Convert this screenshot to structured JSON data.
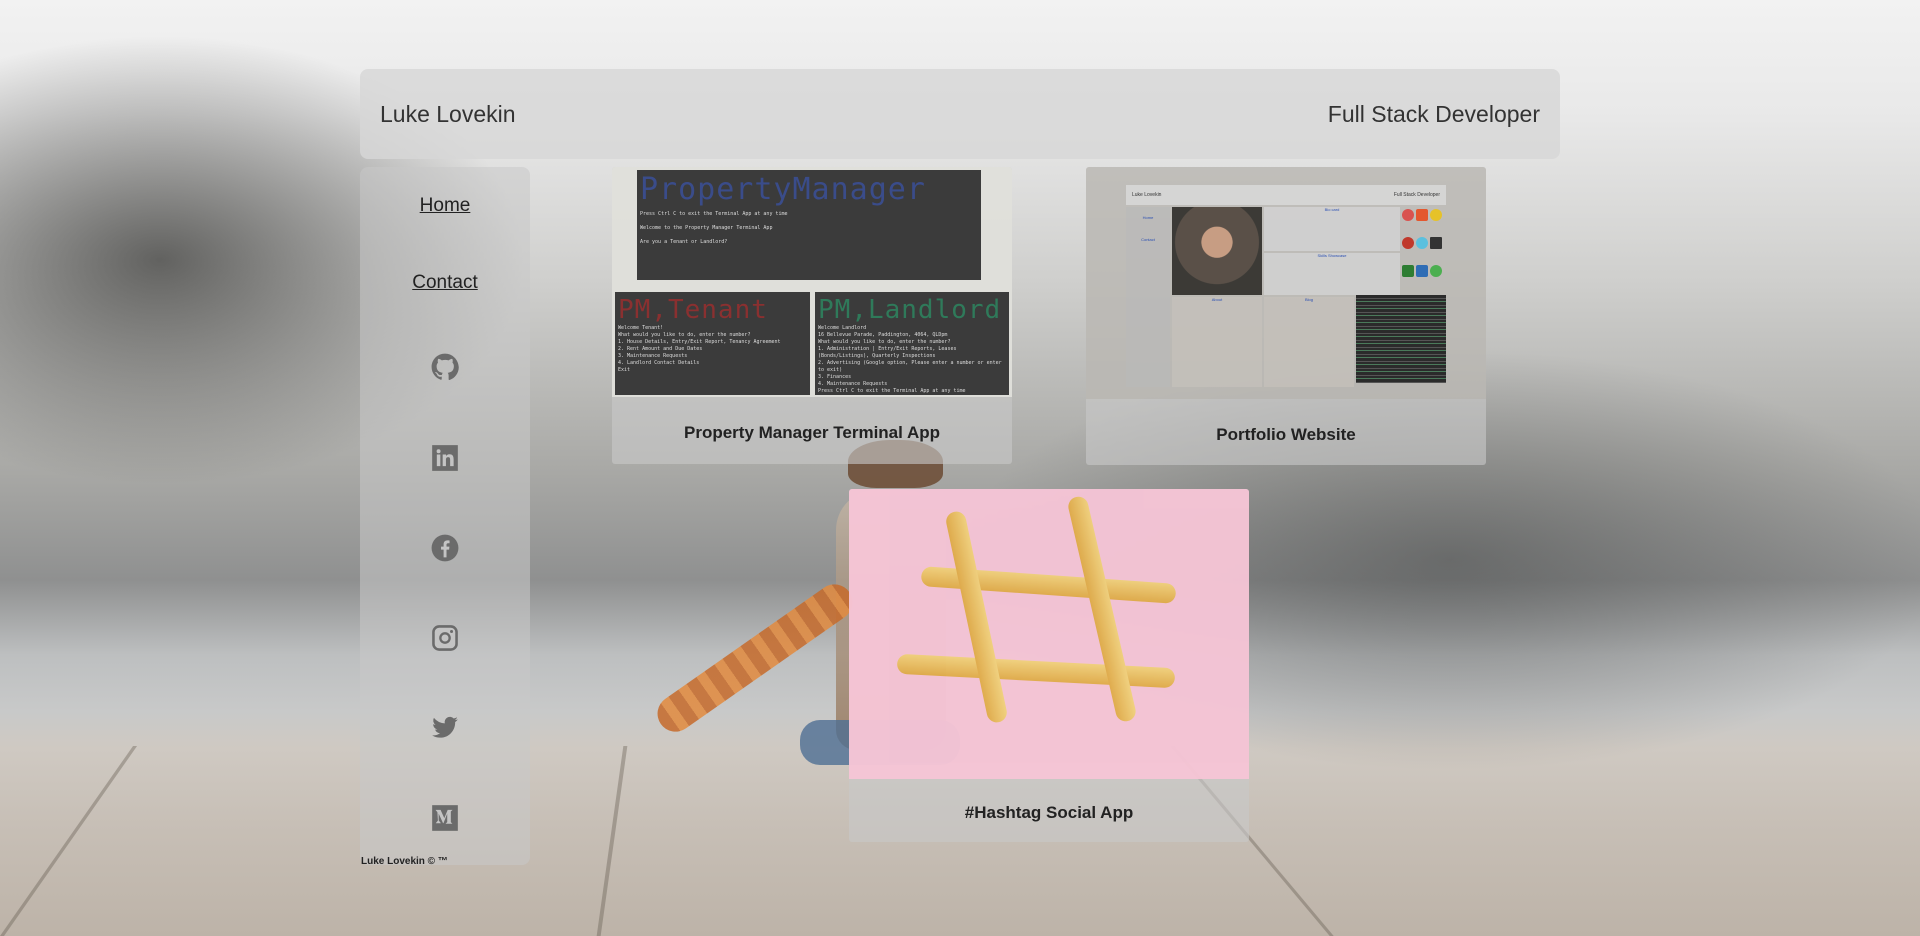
{
  "header": {
    "name": "Luke Lovekin",
    "role": "Full Stack Developer"
  },
  "nav": {
    "home": "Home",
    "contact": "Contact"
  },
  "social_icons": [
    "github-icon",
    "linkedin-icon",
    "facebook-icon",
    "instagram-icon",
    "twitter-icon",
    "medium-icon"
  ],
  "footer": {
    "copyright": "Luke Lovekin © ™"
  },
  "projects": [
    {
      "title": "Property Manager Terminal App",
      "screens": {
        "banner": "PropertyManager",
        "lines": [
          "Press Ctrl C to exit the Terminal App at any time",
          "Welcome to the Property Manager Terminal App",
          "Are you a Tenant or Landlord?"
        ],
        "tenant_banner": "PM,Tenant",
        "tenant_lines": [
          "Welcome Tenant!",
          "What would you like to do, enter the number?",
          "1. House Details, Entry/Exit Report, Tenancy Agreement",
          "2. Rent Amount and Due Dates",
          "3. Maintenance Requests",
          "4. Landlord Contact Details",
          "Exit"
        ],
        "landlord_banner": "PM,Landlord",
        "landlord_lines": [
          "Welcome Landlord",
          "16 Bellevue Parade, Paddington, 4064, QLDpm",
          "What would you like to do, enter the number?",
          "1. Administration | Entry/Exit Reports, Leases (Bonds/Listings), Quarterly Inspections",
          "2. Advertising (Google option, Please enter a number or enter to exit)",
          "3. Finances",
          "4. Maintenance Requests",
          "Press Ctrl C to exit the Terminal App at any time"
        ]
      }
    },
    {
      "title": "Portfolio Website",
      "screens": {
        "name": "Luke Lovekin",
        "role": "Full Stack Developer",
        "link_a": "Home",
        "link_b": "Contact",
        "box_a": "Bio card",
        "box_b": "Skills Showcase",
        "box_c": "About",
        "box_d": "Blog"
      }
    },
    {
      "title": "#Hashtag Social App"
    }
  ],
  "colors": {
    "header_bg": "#d7d7d7",
    "sidebar_bg": "#c8c8c8",
    "card_bg": "#c8c8c8",
    "hashtag_bg": "#f7c4d6",
    "terminal_bg": "#3b3b3b",
    "pm_blue": "#3a4c8a",
    "pm_red": "#8a3030",
    "pm_green": "#2f7a5a"
  }
}
